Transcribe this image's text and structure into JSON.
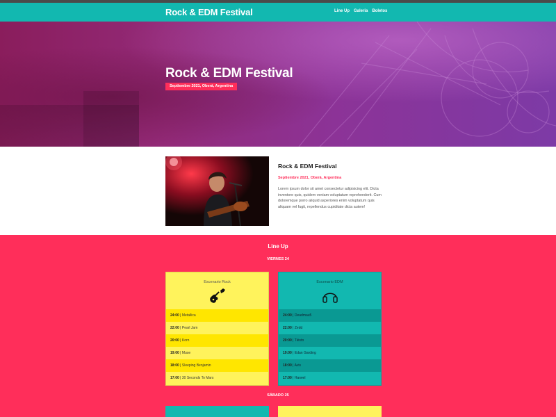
{
  "nav": {
    "brand": "Rock & EDM Festival",
    "links": [
      "Line Up",
      "Galeria",
      "Boletos"
    ]
  },
  "hero": {
    "title": "Rock & EDM Festival",
    "badge": "Septiembre 2021, Oberá, Argentina"
  },
  "about": {
    "title": "Rock & EDM Festival",
    "date": "Septiembre 2021, Oberá, Argentina",
    "text": "Lorem ipsum dolor sit amet consectetur adipisicing elit. Dicta inventore quis, quidem veniam voluptatum reprehenderit. Cum doloremque porro aliquid asperiores enim voluptatum quis aliquam vel fugit, repellendus cupiditate dicta autem!"
  },
  "lineup": {
    "title": "Line Up",
    "day1": "VIERNES 24",
    "day2": "SÁBADO 25",
    "rock": {
      "name": "Escenario Rock",
      "icon": "guitar-icon",
      "items": [
        {
          "time": "24:00",
          "band": "Metallica"
        },
        {
          "time": "22:00",
          "band": "Pearl Jam"
        },
        {
          "time": "20:00",
          "band": "Korn"
        },
        {
          "time": "19:00",
          "band": "Muse"
        },
        {
          "time": "18:00",
          "band": "Sleeping Benjamin"
        },
        {
          "time": "17:00",
          "band": "30 Seconds To Mars"
        }
      ]
    },
    "edm": {
      "name": "Escenario EDM",
      "icon": "headphones-icon",
      "items": [
        {
          "time": "24:00",
          "band": "Deadmau5"
        },
        {
          "time": "22:00",
          "band": "Zedd"
        },
        {
          "time": "20:00",
          "band": "Tiësto"
        },
        {
          "time": "19:00",
          "band": "Edan Garding"
        },
        {
          "time": "18:00",
          "band": "Avis"
        },
        {
          "time": "17:00",
          "band": "Harwel"
        }
      ]
    }
  },
  "colors": {
    "teal": "#12b8b0",
    "pink": "#ff2e5a",
    "yellow": "#fff35c",
    "yellow_dark": "#ffe600",
    "purple": "#8c3397"
  }
}
